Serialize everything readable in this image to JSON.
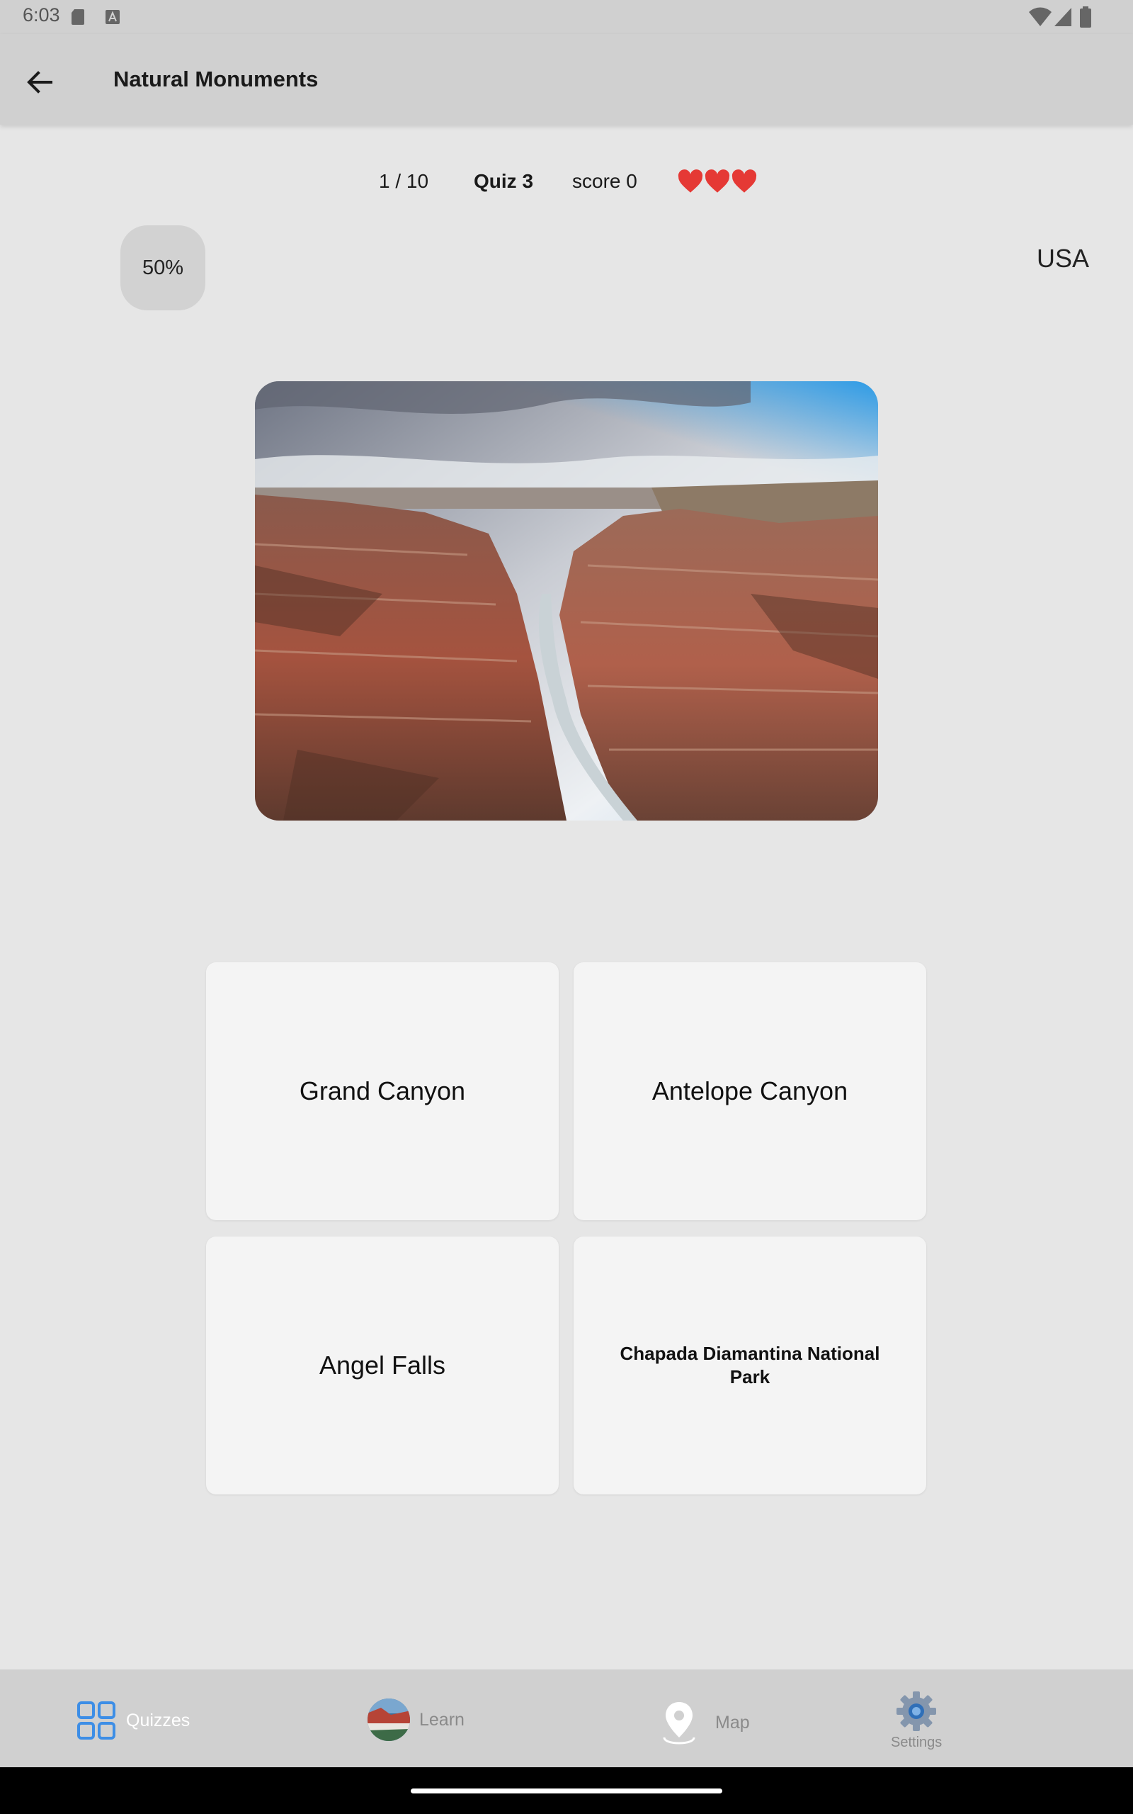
{
  "status_bar": {
    "time": "6:03"
  },
  "app_bar": {
    "title": "Natural Monuments",
    "back_icon": "arrow-left-icon"
  },
  "quiz": {
    "progress": "1 / 10",
    "quiz_name": "Quiz 3",
    "score": "score 0",
    "lives": 3,
    "hint": "50%",
    "country": "USA"
  },
  "answers": [
    {
      "label": "Grand Canyon",
      "style": "big"
    },
    {
      "label": "Antelope Canyon",
      "style": "big"
    },
    {
      "label": "Angel Falls",
      "style": "big"
    },
    {
      "label": "Chapada Diamantina National Park",
      "style": "small"
    }
  ],
  "bottom_nav": {
    "active": "quizzes",
    "items": [
      {
        "id": "quizzes",
        "label": "Quizzes",
        "icon": "grid-icon"
      },
      {
        "id": "learn",
        "label": "Learn",
        "icon": "learn-thumbnail-icon"
      },
      {
        "id": "map",
        "label": "Map",
        "icon": "map-pin-icon"
      },
      {
        "id": "settings",
        "label": "Settings",
        "icon": "gear-icon"
      }
    ]
  },
  "colors": {
    "accent": "#3d8ee6",
    "heart": "#e53935",
    "bar": "#d0d0d0",
    "background": "#e6e6e6"
  }
}
